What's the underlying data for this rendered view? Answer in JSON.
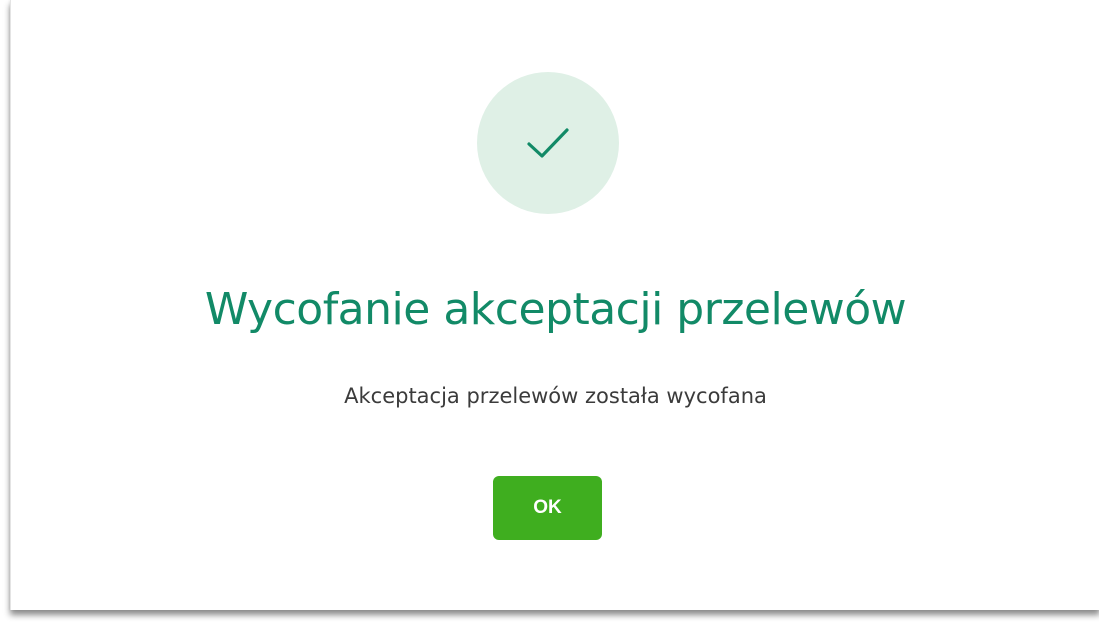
{
  "dialog": {
    "status_icon": "checkmark-icon",
    "title": "Wycofanie akceptacji przelewów",
    "message": "Akceptacja przelewów została wycofana",
    "ok_label": "OK"
  },
  "colors": {
    "brand_green": "#128a67",
    "circle_bg": "#dff0e6",
    "button_green": "#3fae1f"
  }
}
